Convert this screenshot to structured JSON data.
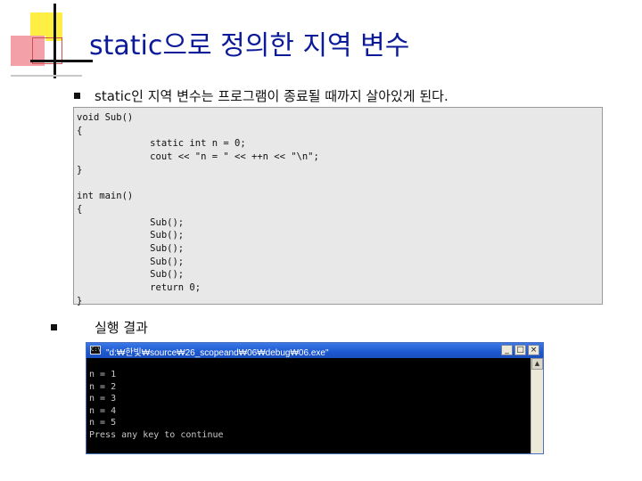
{
  "slide": {
    "title": "static으로 정의한 지역 변수"
  },
  "bullets": [
    {
      "text": "static인 지역 변수는 프로그램이 종료될 때까지 살아있게 된다."
    },
    {
      "text": "실행 결과"
    }
  ],
  "code": {
    "text": "void Sub()\n{\n             static int n = 0;\n             cout << \"n = \" << ++n << \"\\n\";\n}\n\nint main()\n{\n             Sub();\n             Sub();\n             Sub();\n             Sub();\n             Sub();\n             return 0;\n}"
  },
  "console": {
    "title": "\"d:₩한빛₩source₩26_scopeand₩06₩debug₩06.exe\"",
    "output": "n = 1\nn = 2\nn = 3\nn = 4\nn = 5\nPress any key to continue",
    "icon": "cmd-icon",
    "minimize_label": "_",
    "maximize_label": "□",
    "close_label": "×"
  },
  "colors": {
    "title": "#0b1a99",
    "titlebar": "#1d58d0",
    "code_bg": "#e8e8e8"
  }
}
